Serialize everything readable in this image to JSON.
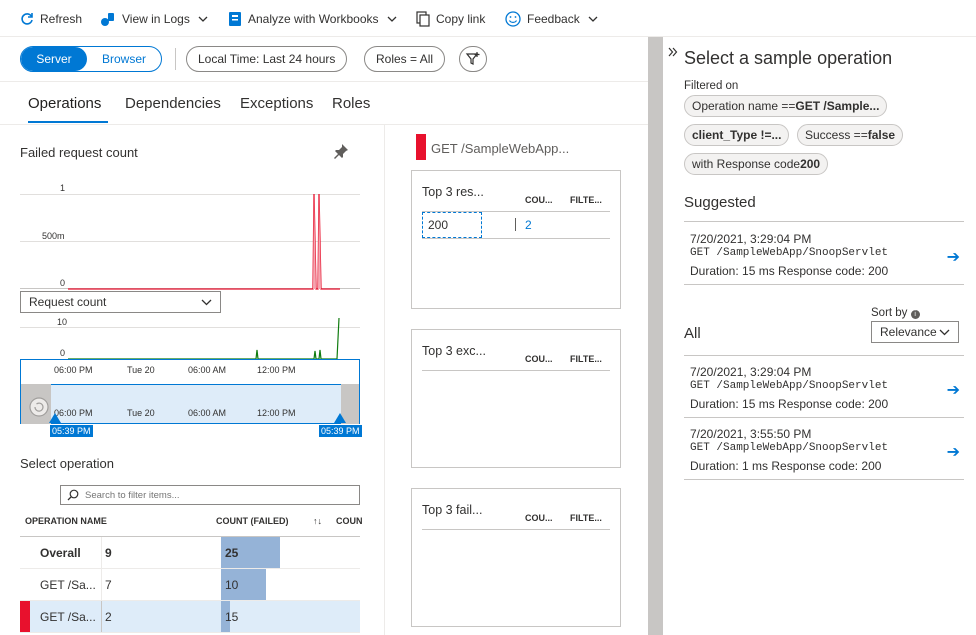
{
  "toolbar": {
    "refresh": "Refresh",
    "view_in_logs": "View in Logs",
    "analyze": "Analyze with Workbooks",
    "copy_link": "Copy link",
    "feedback": "Feedback"
  },
  "filters": {
    "server": "Server",
    "browser": "Browser",
    "time": "Local Time: Last 24 hours",
    "roles": "Roles = All"
  },
  "tabs": [
    "Operations",
    "Dependencies",
    "Exceptions",
    "Roles"
  ],
  "failed_chart": {
    "title": "Failed request count",
    "y_ticks": [
      "1",
      "500m",
      "0"
    ]
  },
  "request_dropdown": "Request count",
  "request_chart": {
    "y_ticks": [
      "10",
      "0"
    ]
  },
  "time_axis": [
    "06:00 PM",
    "Tue 20",
    "06:00 AM",
    "12:00 PM"
  ],
  "brush": {
    "start": "05:39 PM",
    "end": "05:39 PM"
  },
  "select_operation": {
    "title": "Select operation",
    "search_placeholder": "Search to filter items...",
    "col_name": "OPERATION NAME",
    "col_count": "COUNT (FAILED)",
    "col_count2": "COUN",
    "sort_glyph": "↑↓",
    "rows": [
      {
        "name": "Overall",
        "n": "9",
        "failed": "25",
        "frac": 0.59
      },
      {
        "name": "GET /Sa...",
        "n": "7",
        "failed": "10",
        "frac": 0.45
      },
      {
        "name": "GET /Sa...",
        "n": "2",
        "failed": "15",
        "frac": 0.09
      }
    ]
  },
  "selected_op": "GET /SampleWebApp...",
  "cards": [
    {
      "title": "Top 3 res...",
      "col1": "COU...",
      "col2": "FILTE...",
      "value": "200",
      "count": "2"
    },
    {
      "title": "Top 3 exc...",
      "col1": "COU...",
      "col2": "FILTE..."
    },
    {
      "title": "Top 3 fail...",
      "col1": "COU...",
      "col2": "FILTE..."
    }
  ],
  "right_pane": {
    "title": "Select a sample operation",
    "filtered_on": "Filtered on",
    "chips": {
      "c1_prefix": "Operation name == ",
      "c1_value": "GET /Sample...",
      "c2_value": "client_Type !=...",
      "c3_prefix": "Success == ",
      "c3_value": "false",
      "c4_prefix": "with Response code ",
      "c4_value": "200"
    },
    "suggested": "Suggested",
    "sort_by": "Sort by",
    "sort_value": "Relevance",
    "all": "All",
    "suggested_items": [
      {
        "time": "7/20/2021, 3:29:04 PM",
        "op": "GET /SampleWebApp/SnoopServlet",
        "duration": "Duration: 15 ms",
        "code": "Response code: 200"
      }
    ],
    "all_items": [
      {
        "time": "7/20/2021, 3:29:04 PM",
        "op": "GET /SampleWebApp/SnoopServlet",
        "duration": "Duration: 15 ms",
        "code": "Response code: 200"
      },
      {
        "time": "7/20/2021, 3:55:50 PM",
        "op": "GET /SampleWebApp/SnoopServlet",
        "duration": "Duration: 1 ms",
        "code": "Response code: 200"
      }
    ]
  },
  "colors": {
    "accent": "#0078d4",
    "failed": "#e8112d",
    "request_line": "#107c10",
    "bar": "#95b3d7",
    "selected_row": "#deecf9"
  }
}
